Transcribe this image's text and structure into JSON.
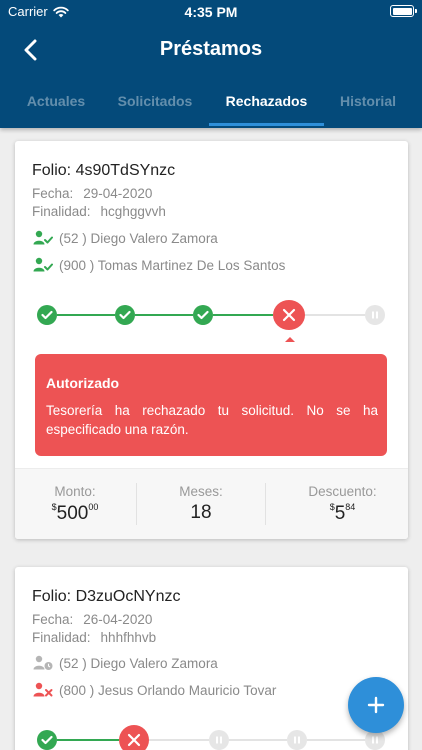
{
  "status_bar": {
    "carrier": "Carrier",
    "time": "4:35 PM"
  },
  "header": {
    "title": "Préstamos"
  },
  "tabs": [
    {
      "label": "Actuales",
      "active": false
    },
    {
      "label": "Solicitados",
      "active": false
    },
    {
      "label": "Rechazados",
      "active": true
    },
    {
      "label": "Historial",
      "active": false
    }
  ],
  "colors": {
    "appbar": "#044a7a",
    "accent": "#2e8fd9",
    "success": "#33a852",
    "danger": "#ed5354",
    "pending": "#d9d9d9"
  },
  "loans": [
    {
      "folio": "Folio: 4s90TdSYnzc",
      "fecha_label": "Fecha:",
      "fecha": "29-04-2020",
      "finalidad_label": "Finalidad:",
      "finalidad": "hcghggvvh",
      "people": [
        {
          "text": "(52 ) Diego Valero Zamora",
          "icon": "user-check-icon",
          "status": "approved"
        },
        {
          "text": "(900 ) Tomas Martinez De Los Santos",
          "icon": "user-check-icon",
          "status": "approved"
        }
      ],
      "steps": [
        "approved",
        "approved",
        "approved",
        "rejected",
        "pending"
      ],
      "rejection": {
        "title": "Autorizado",
        "message": "Tesorería ha rechazado tu solicitud. No se ha especificado una razón."
      },
      "summary": {
        "monto_label": "Monto:",
        "monto_symbol": "$",
        "monto": "500",
        "monto_cents": "00",
        "meses_label": "Meses:",
        "meses": "18",
        "descuento_label": "Descuento:",
        "descuento_symbol": "$",
        "descuento": "5",
        "descuento_cents": "84"
      }
    },
    {
      "folio": "Folio: D3zuOcNYnzc",
      "fecha_label": "Fecha:",
      "fecha": "26-04-2020",
      "finalidad_label": "Finalidad:",
      "finalidad": "hhhfhhvb",
      "people": [
        {
          "text": "(52 ) Diego Valero Zamora",
          "icon": "user-clock-icon",
          "status": "pending"
        },
        {
          "text": "(800 ) Jesus Orlando Mauricio Tovar",
          "icon": "user-x-icon",
          "status": "rejected"
        }
      ],
      "steps": [
        "approved",
        "rejected",
        "pending",
        "pending",
        "pending"
      ]
    }
  ]
}
